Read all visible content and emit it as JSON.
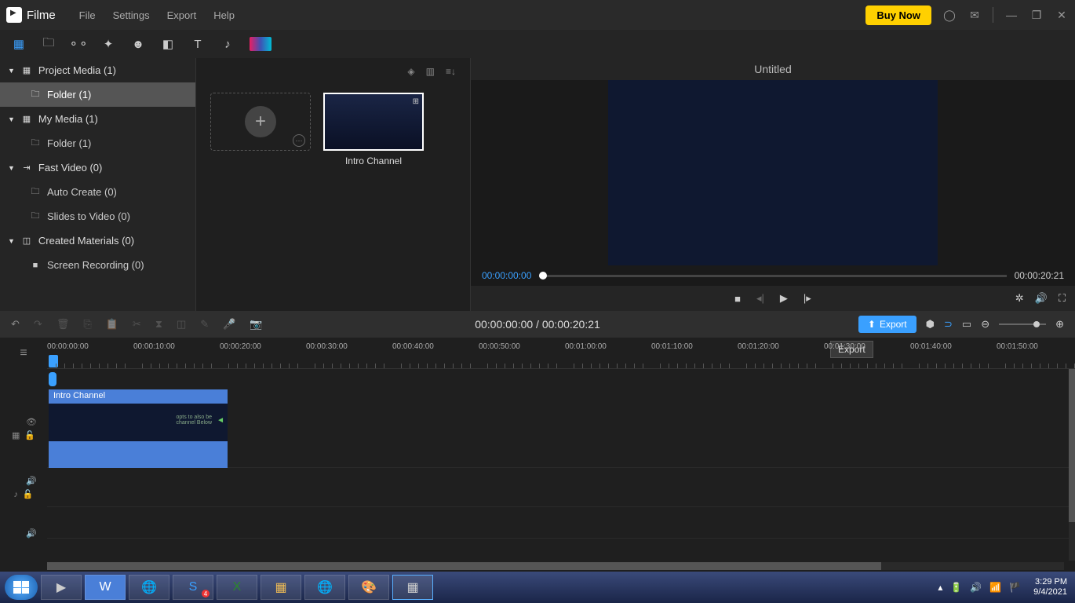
{
  "app": {
    "name": "Filme"
  },
  "menu": {
    "file": "File",
    "settings": "Settings",
    "export": "Export",
    "help": "Help"
  },
  "titlebar": {
    "buy_now": "Buy Now"
  },
  "sidebar": {
    "project_media": "Project Media (1)",
    "folder1": "Folder (1)",
    "my_media": "My Media (1)",
    "folder2": "Folder (1)",
    "fast_video": "Fast Video (0)",
    "auto_create": "Auto Create (0)",
    "slides_video": "Slides to Video (0)",
    "created_materials": "Created Materials (0)",
    "screen_recording": "Screen Recording (0)"
  },
  "media": {
    "clip1": "Intro Channel"
  },
  "preview": {
    "title": "Untitled",
    "time_start": "00:00:00:00",
    "time_end": "00:00:20:21"
  },
  "timeline_toolbar": {
    "position": "00:00:00:00 / 00:00:20:21",
    "export": "Export",
    "tooltip": "Export"
  },
  "ruler": [
    "00:00:00:00",
    "00:00:10:00",
    "00:00:20:00",
    "00:00:30:00",
    "00:00:40:00",
    "00:00:50:00",
    "00:01:00:00",
    "00:01:10:00",
    "00:01:20:00",
    "00:01:30:00",
    "00:01:40:00",
    "00:01:50:00"
  ],
  "tracks": {
    "clip_label": "Intro Channel"
  },
  "taskbar": {
    "skype_badge": "4",
    "time": "3:29 PM",
    "date": "9/4/2021"
  }
}
